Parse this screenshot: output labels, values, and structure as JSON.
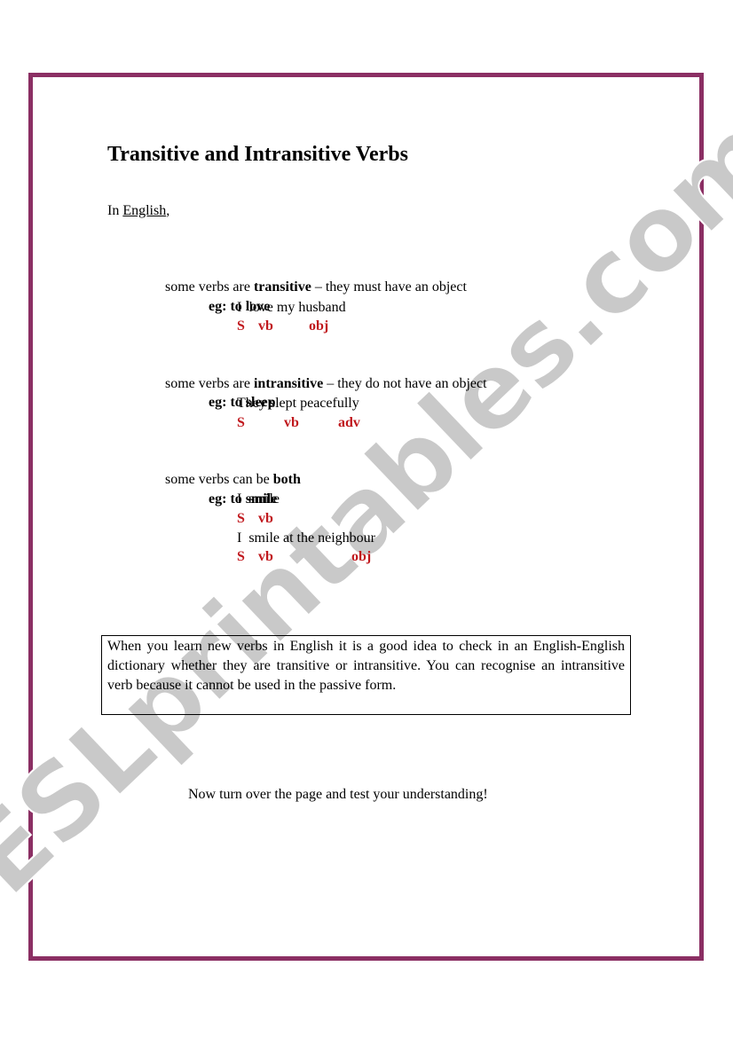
{
  "page": {
    "frame_color": "#8b2f63",
    "watermark": "ESLprintables.com",
    "title": "Transitive and Intransitive Verbs",
    "intro": {
      "prefix": "In ",
      "link": "English",
      "suffix": ","
    },
    "sections": [
      {
        "statement": {
          "before": "some verbs are ",
          "keyword": "transitive",
          "after": " – they must have an object"
        },
        "example": {
          "eg": "eg: ",
          "verb": "to love"
        },
        "sentences": [
          {
            "text": "I  love my husband",
            "tags": [
              "S",
              "vb",
              "obj"
            ]
          }
        ]
      },
      {
        "statement": {
          "before": "some verbs are ",
          "keyword": "intransitive",
          "after": " – they do not have an object"
        },
        "example": {
          "eg": "eg: ",
          "verb": "to sleep"
        },
        "sentences": [
          {
            "text": "They slept peacefully",
            "tags": [
              "S",
              "vb",
              "adv"
            ]
          }
        ]
      },
      {
        "statement": {
          "before": "some verbs can be ",
          "keyword": "both",
          "after": ""
        },
        "example": {
          "eg": "eg: ",
          "verb": "to smile"
        },
        "sentences": [
          {
            "text": "I  smile",
            "tags": [
              "S",
              "vb"
            ]
          },
          {
            "text": "I  smile at the neighbour",
            "tags": [
              "S",
              "vb",
              "obj"
            ]
          }
        ]
      }
    ],
    "note": "When you learn new verbs in English it is a good idea to check in an English-English dictionary whether they are transitive or intransitive. You can recognise an intransitive verb because it cannot be used in the passive form.",
    "closing": "Now turn over the page and test your understanding!",
    "tag_color": "#c0181d"
  }
}
